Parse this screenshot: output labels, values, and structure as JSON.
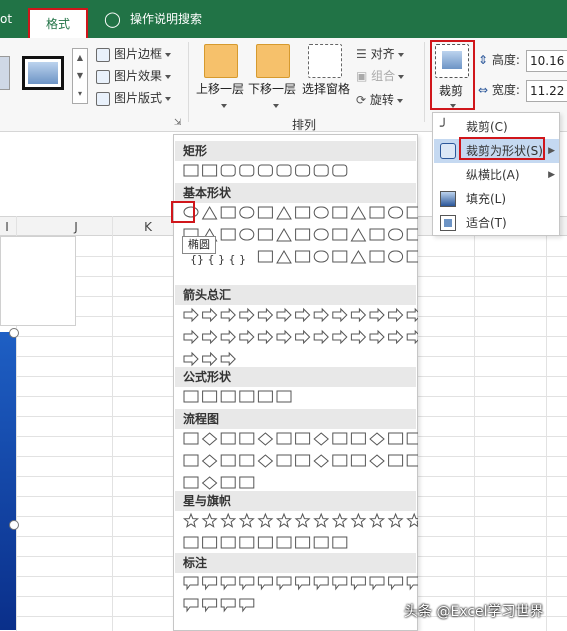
{
  "titlebar": {
    "tab_partial": "ot",
    "tab_active": "格式",
    "search_tip": "操作说明搜索"
  },
  "ribbon": {
    "picture_border": "图片边框",
    "picture_effects": "图片效果",
    "picture_layout": "图片版式",
    "bring_forward": "上移一层",
    "send_backward": "下移一层",
    "selection_pane": "选择窗格",
    "align": "对齐",
    "group": "组合",
    "rotate": "旋转",
    "arrange_group": "排列",
    "crop": "裁剪",
    "height_label": "高度:",
    "height_value": "10.16",
    "width_label": "宽度:",
    "width_value": "11.22"
  },
  "sheet": {
    "col_i": "I",
    "col_j": "J",
    "col_k": "K"
  },
  "shapes": {
    "sec_rect": "矩形",
    "sec_basic": "基本形状",
    "sec_arrows": "箭头总汇",
    "sec_equation": "公式形状",
    "sec_flowchart": "流程图",
    "sec_stars": "星与旗帜",
    "sec_callouts": "标注",
    "tooltip": "椭圆",
    "row_basic_3_text": "{} {  } {  }"
  },
  "cropmenu": {
    "crop": "裁剪(C)",
    "crop_to_shape": "裁剪为形状(S)",
    "aspect_ratio": "纵横比(A)",
    "fill": "填充(L)",
    "fit": "适合(T)"
  },
  "watermark": "头条 @Excel学习世界",
  "colors": {
    "excel_green": "#217346",
    "highlight_red": "#d0161b",
    "menu_hover": "#c5d9f1"
  }
}
